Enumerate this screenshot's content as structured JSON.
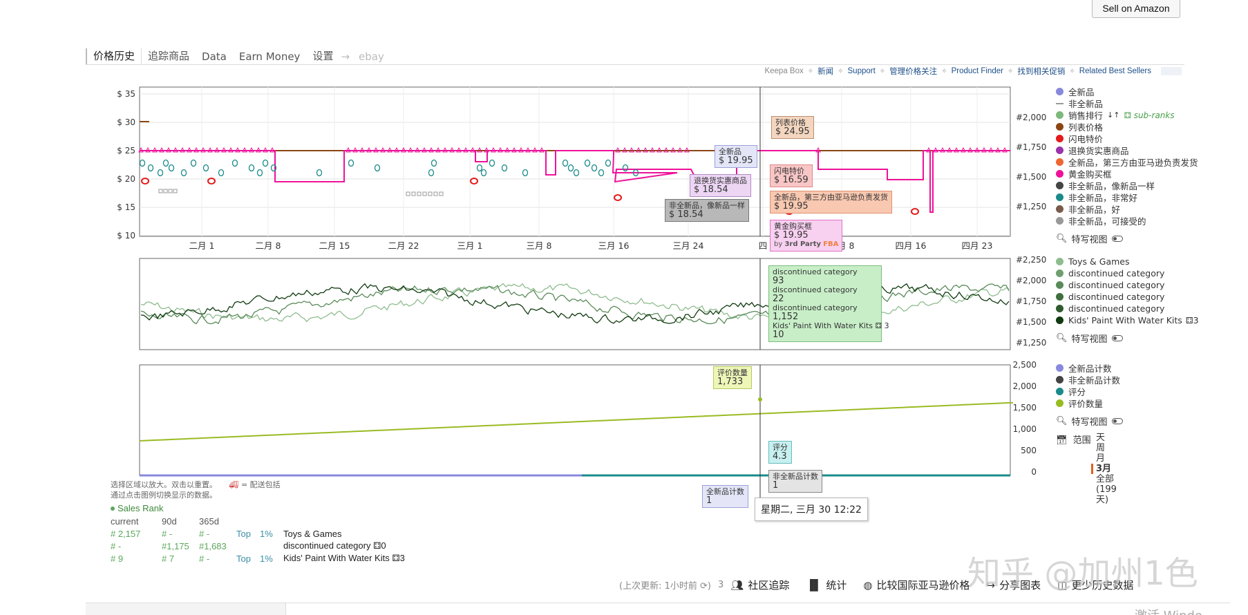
{
  "header": {
    "sell_button": "Sell on Amazon"
  },
  "tabs": [
    {
      "label": "价格历史",
      "active": true
    },
    {
      "label": "追踪商品"
    },
    {
      "label": "Data"
    },
    {
      "label": "Earn Money"
    },
    {
      "label": "设置"
    },
    {
      "label": "ebay",
      "faded": true
    }
  ],
  "tab_arrow": "→",
  "toplinks": [
    "Keepa Box",
    "新闻",
    "Support",
    "管理价格关注",
    "Product Finder",
    "找到相关促销",
    "Related Best Sellers"
  ],
  "price_chart": {
    "y_ticks": [
      "$ 35",
      "$ 30",
      "$ 25",
      "$ 20",
      "$ 15",
      "$ 10"
    ],
    "y_right_ticks": [
      "#2,000",
      "#1,750",
      "#1,500",
      "#1,250"
    ],
    "x_ticks": [
      "二月 1",
      "二月 8",
      "二月 15",
      "二月 22",
      "三月 1",
      "三月 8",
      "三月 16",
      "三月 24",
      "四",
      "四月 8",
      "四月 16",
      "四月 23"
    ]
  },
  "rank_chart": {
    "y_right_ticks": [
      "#2,250",
      "#2,000",
      "#1,750",
      "#1,500",
      "#1,250"
    ]
  },
  "count_chart": {
    "y_right_ticks": [
      "2,500",
      "2,000",
      "1,500",
      "1,000",
      "500",
      "0"
    ]
  },
  "tooltips": {
    "list_price": {
      "label": "列表价格",
      "value": "$ 24.95"
    },
    "new": {
      "label": "全新品",
      "value": "$ 19.95"
    },
    "warehouse": {
      "label": "退换货实惠商品",
      "value": "$ 18.54"
    },
    "used_like_new": {
      "label": "非全新品，像新品一样",
      "value": "$ 18.54"
    },
    "lightning": {
      "label": "闪电特价",
      "value": "$ 16.59"
    },
    "new_3rd_fba": {
      "label": "全新品，第三方由亚马逊负责发货",
      "value": "$ 19.95"
    },
    "buybox": {
      "label": "黄金购买框",
      "value": "$ 19.95",
      "by": "by",
      "seller": "3rd Party",
      "fba": "FBA"
    },
    "rank": [
      {
        "label": "discontinued category",
        "value": "93"
      },
      {
        "label": "discontinued category",
        "value": "22"
      },
      {
        "label": "discontinued category",
        "value": "1,152"
      },
      {
        "label": "Kids' Paint With Water Kits",
        "extra": "3",
        "value": "10"
      }
    ],
    "review_count": {
      "label": "评价数量",
      "value": "1,733"
    },
    "rating": {
      "label": "评分",
      "value": "4.3"
    },
    "used_count": {
      "label": "非全新品计数",
      "value": "1"
    },
    "new_count": {
      "label": "全新品计数",
      "value": "1"
    },
    "date": "星期二, 三月 30 12:22"
  },
  "legend_price": [
    {
      "label": "全新品",
      "color": "#8888dd",
      "shape": "dot"
    },
    {
      "label": "非全新品",
      "color": "#999999",
      "shape": "dash"
    },
    {
      "label": "销售排行",
      "color": "#7cb87c",
      "shape": "dot",
      "sub": "sub-ranks"
    },
    {
      "label": "列表价格",
      "color": "#8b4513",
      "shape": "dot"
    },
    {
      "label": "闪电特价",
      "color": "#e41a1c",
      "shape": "dot"
    },
    {
      "label": "退换货实惠商品",
      "color": "#9933aa",
      "shape": "dot"
    },
    {
      "label": "全新品，第三方由亚马逊负责发货",
      "color": "#ee6633",
      "shape": "dot"
    },
    {
      "label": "黄金购买框",
      "color": "#ee1199",
      "shape": "dot"
    },
    {
      "label": "非全新品，像新品一样",
      "color": "#444444",
      "shape": "dot"
    },
    {
      "label": "非全新品，非常好",
      "color": "#1a8a8a",
      "shape": "dot"
    },
    {
      "label": "非全新品，好",
      "color": "#7a5a4a",
      "shape": "dot"
    },
    {
      "label": "非全新品，可接受的",
      "color": "#999999",
      "shape": "dot"
    }
  ],
  "legend_rank": [
    {
      "label": "Toys & Games",
      "color": "#8fbc8f"
    },
    {
      "label": "discontinued category",
      "color": "#6f9f6f"
    },
    {
      "label": "discontinued category",
      "color": "#5a8a5a"
    },
    {
      "label": "discontinued category",
      "color": "#3f6f3f"
    },
    {
      "label": "discontinued category",
      "color": "#2f5a2f"
    },
    {
      "label": "Kids' Paint With Water Kits",
      "color": "#103a10",
      "extra": "3"
    }
  ],
  "legend_counts": [
    {
      "label": "全新品计数",
      "color": "#8888dd"
    },
    {
      "label": "非全新品计数",
      "color": "#444444"
    },
    {
      "label": "评分",
      "color": "#1a8a8a"
    },
    {
      "label": "评价数量",
      "color": "#99bb22"
    }
  ],
  "zoom_label": "特写视图",
  "range": {
    "label": "范围",
    "options": [
      "天",
      "周",
      "月",
      "3月",
      "全部 (199 天)"
    ],
    "selected": "3月"
  },
  "hint": {
    "line1": "选择区域以放大。双击以重置。",
    "shipping": "= 配送包括",
    "line2": "通过点击图例切换显示的数据。"
  },
  "sales_rank": {
    "title": "Sales Rank",
    "headers": [
      "current",
      "90d",
      "365d"
    ],
    "rows": [
      {
        "current": "# 2,157",
        "d90": "# -",
        "d365": "# -",
        "top": "Top",
        "pct": "1%",
        "category": "Toys & Games",
        "extra": ""
      },
      {
        "current": "# -",
        "d90": "#1,175",
        "d365": "#1,683",
        "top": "",
        "pct": "",
        "category": "discontinued category",
        "extra": "0"
      },
      {
        "current": "# 9",
        "d90": "# 7",
        "d365": "# -",
        "top": "Top",
        "pct": "1%",
        "category": "Kids' Paint With Water Kits",
        "extra": "3"
      }
    ]
  },
  "footer": {
    "last_update": "(上次更新: 1小时前",
    "community_count": "3",
    "community": "社区追踪",
    "stats": "统计",
    "compare": "比较国际亚马逊价格",
    "share": "分享图表",
    "less_history": "更少历史数据"
  },
  "watermark": "知乎 @加州1色",
  "bottom_partial": "激活 Windo"
}
